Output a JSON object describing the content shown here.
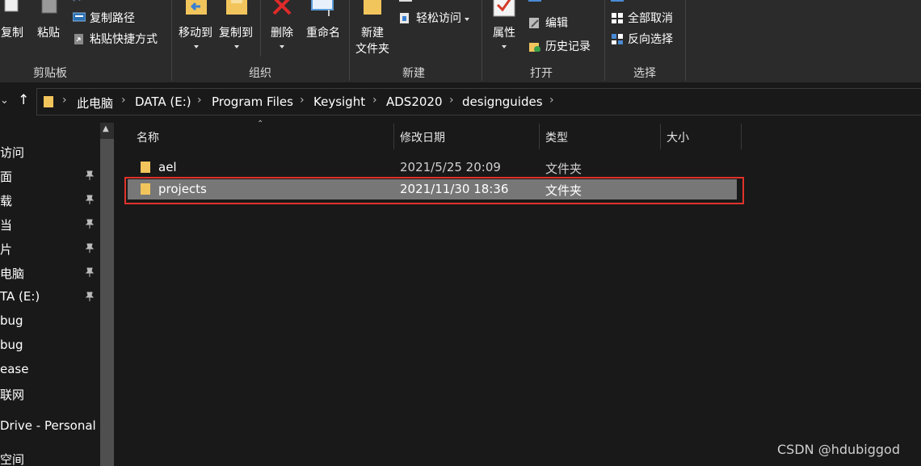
{
  "ribbon": {
    "clipboard": {
      "group_label": "剪贴板",
      "copy_label": "复制",
      "paste_label": "粘贴",
      "copy_path_label": "复制路径",
      "paste_shortcut_label": "粘贴快捷方式"
    },
    "organize": {
      "group_label": "组织",
      "move_to_label": "移动到",
      "copy_to_label": "复制到",
      "delete_label": "删除",
      "rename_label": "重命名"
    },
    "new": {
      "group_label": "新建",
      "new_folder_label_line1": "新建",
      "new_folder_label_line2": "文件夹",
      "easy_access_label": "轻松访问"
    },
    "open": {
      "group_label": "打开",
      "properties_label": "属性",
      "edit_label": "编辑",
      "history_label": "历史记录"
    },
    "select": {
      "group_label": "选择",
      "select_none_label": "全部取消",
      "invert_selection_label": "反向选择"
    }
  },
  "address": {
    "breadcrumbs": [
      "此电脑",
      "DATA (E:)",
      "Program Files",
      "Keysight",
      "ADS2020",
      "designguides"
    ]
  },
  "nav": {
    "items": [
      "访问",
      "面",
      "载",
      "当",
      "片",
      "电脑",
      "TA (E:)",
      "bug",
      "bug",
      "ease",
      "联网",
      "Drive - Personal",
      "空间"
    ]
  },
  "columns": {
    "name": "名称",
    "modified": "修改日期",
    "type": "类型",
    "size": "大小"
  },
  "files": [
    {
      "name": "ael",
      "modified": "2021/5/25 20:09",
      "type": "文件夹",
      "selected": false
    },
    {
      "name": "projects",
      "modified": "2021/11/30 18:36",
      "type": "文件夹",
      "selected": true
    }
  ],
  "watermark": "CSDN @hdubiggod",
  "colors": {
    "background": "#191919",
    "ribbon": "#2b2b2b",
    "selection": "#777777",
    "highlight_box": "#e0322b",
    "folder": "#f2c55c"
  }
}
